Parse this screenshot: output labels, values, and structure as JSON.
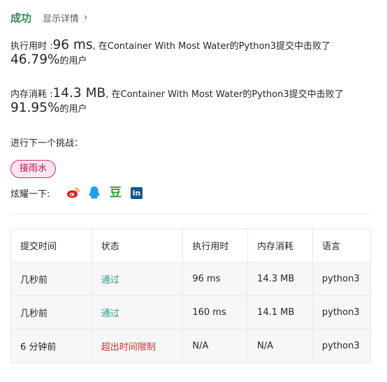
{
  "header": {
    "result": "成功",
    "detail_link": "显示详情"
  },
  "runtime": {
    "label": "执行用时 : ",
    "value": "96 ms",
    "sentence": ", 在Container With Most Water的Python3提交中击败了",
    "percent": "46.79%",
    "suffix": " 的用户"
  },
  "memory": {
    "label": "内存消耗 : ",
    "value": "14.3 MB",
    "sentence": ", 在Container With Most Water的Python3提交中击败了",
    "percent": "91.95%",
    "suffix": " 的用户"
  },
  "next": {
    "label": "进行下一个挑战：",
    "tag": "接雨水"
  },
  "share": {
    "label": "炫耀一下:",
    "icons": [
      "weibo-icon",
      "qq-icon",
      "douban-icon",
      "linkedin-icon"
    ],
    "douban_glyph": "豆",
    "linkedin_glyph": "in"
  },
  "colors": {
    "accent_green": "#2e8b57",
    "status_ok": "#2a9c8c",
    "status_fail": "#d0312d",
    "tag_pink": "#d12d6f"
  },
  "table": {
    "headers": [
      "提交时间",
      "状态",
      "执行用时",
      "内存消耗",
      "语言"
    ],
    "rows": [
      [
        "几秒前",
        "通过",
        "96 ms",
        "14.3 MB",
        "python3"
      ],
      [
        "几秒前",
        "通过",
        "160 ms",
        "14.1 MB",
        "python3"
      ],
      [
        "6 分钟前",
        "超出时间限制",
        "N/A",
        "N/A",
        "python3"
      ]
    ]
  }
}
